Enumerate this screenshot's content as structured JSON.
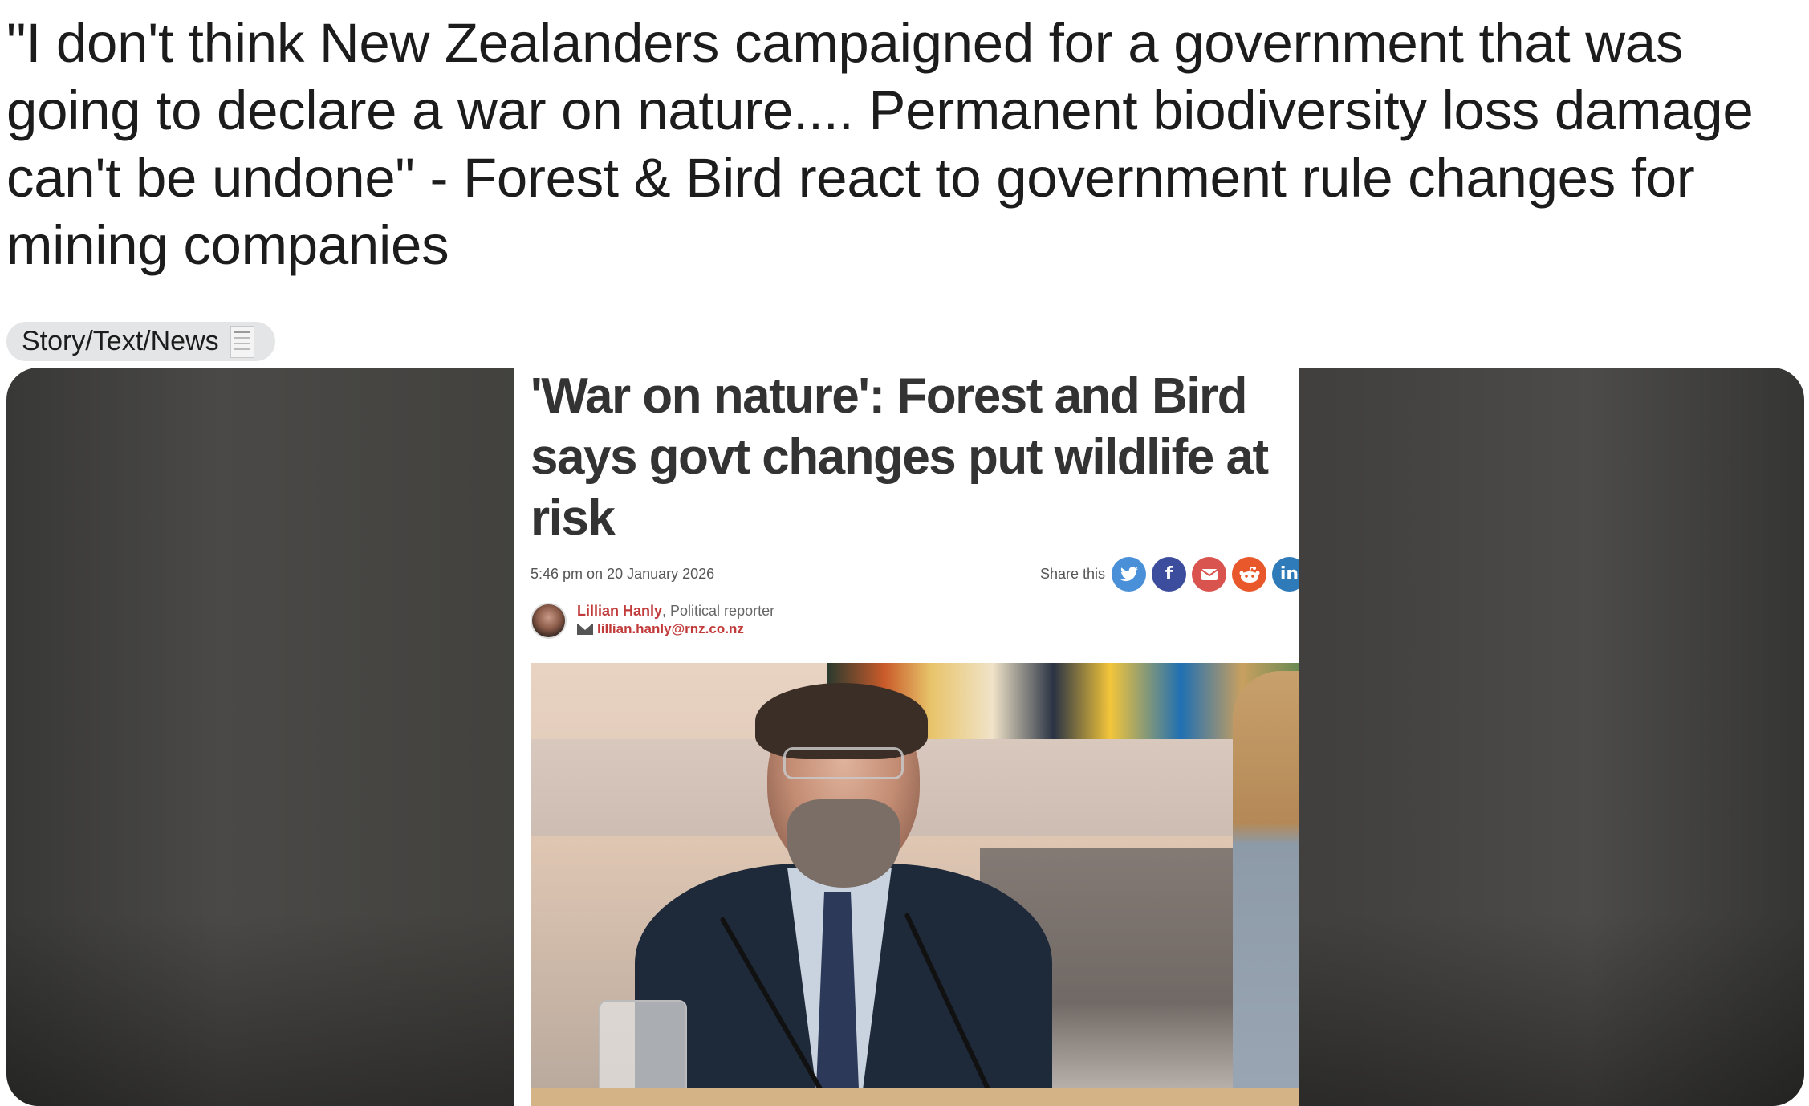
{
  "post": {
    "title": "\"I don't think New Zealanders campaigned for a government that was going to declare a war on nature.... Permanent biodiversity loss damage can't be undone\" - Forest & Bird react to government rule changes for mining companies",
    "flair_label": "Story/Text/News",
    "flair_icon": "receipt-icon"
  },
  "article": {
    "headline": "'War on nature': Forest and Bird says govt changes put wildlife at risk",
    "dateline": "5:46 pm on 20 January 2026",
    "share_label": "Share this",
    "share_icons": [
      {
        "name": "twitter-icon",
        "glyph": "🐦",
        "color": "#4a90d9"
      },
      {
        "name": "facebook-icon",
        "glyph": "f",
        "color": "#3b4d9c"
      },
      {
        "name": "email-icon",
        "glyph": "✉",
        "color": "#d9534f"
      },
      {
        "name": "reddit-icon",
        "glyph": "●",
        "color": "#e8582a"
      },
      {
        "name": "linkedin-icon",
        "glyph": "in",
        "color": "#2f7ab8"
      }
    ],
    "author_name": "Lillian Hanly",
    "author_role": ", Political reporter",
    "author_email": "lillian.hanly@rnz.co.nz"
  }
}
